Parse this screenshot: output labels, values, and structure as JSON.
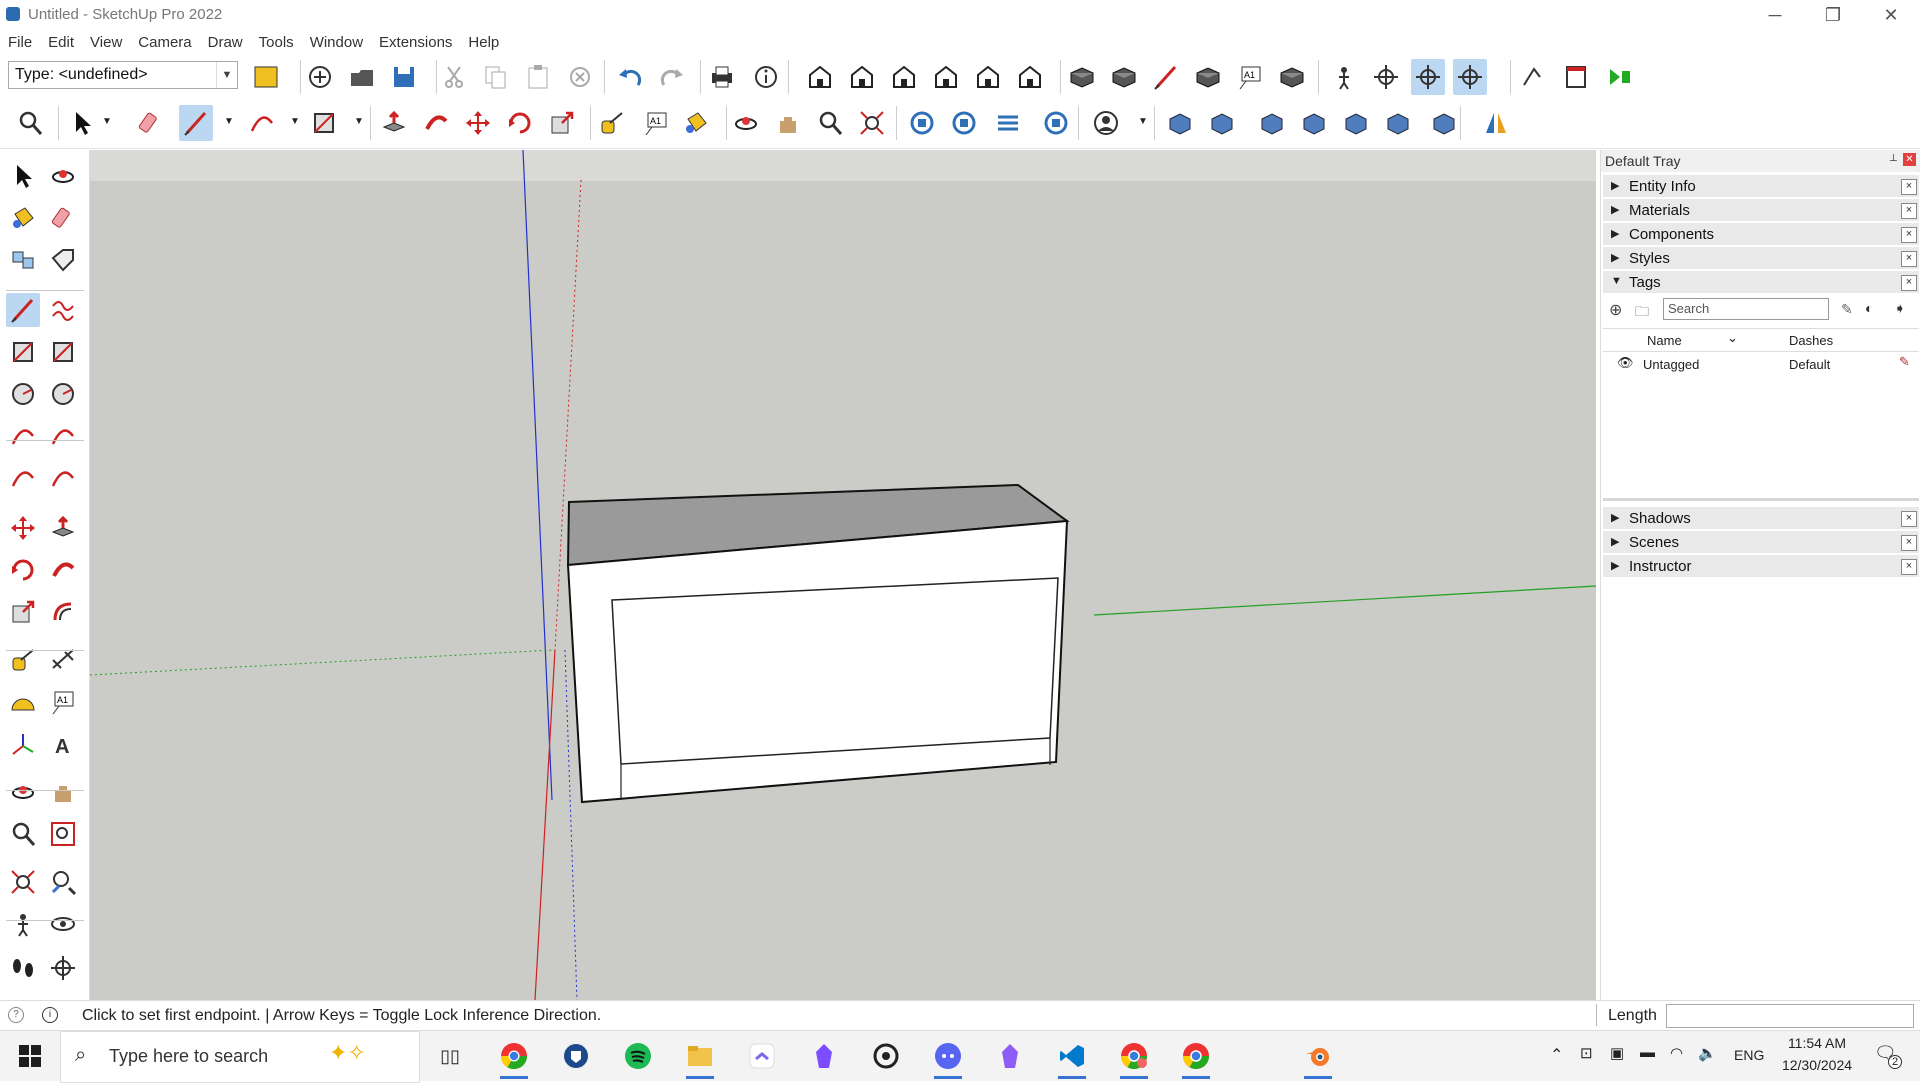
{
  "window": {
    "title": "Untitled - SketchUp Pro 2022",
    "min": "─",
    "restore": "❐",
    "close": "✕"
  },
  "menu": [
    "File",
    "Edit",
    "View",
    "Camera",
    "Draw",
    "Tools",
    "Window",
    "Extensions",
    "Help"
  ],
  "toolbar": {
    "type_selector": "Type: <undefined>",
    "top_row_icons": [
      "component-options-icon",
      "new-icon",
      "open-icon",
      "save-icon",
      "cut-icon",
      "copy-icon",
      "paste-icon",
      "erase-icon",
      "undo-icon",
      "redo-icon",
      "print-icon",
      "model-info-icon",
      "iso-view-icon",
      "top-view-icon",
      "front-view-icon",
      "right-view-icon",
      "back-view-icon",
      "left-view-icon",
      "xray-icon",
      "wireframe-icon",
      "hidden-line-icon",
      "shaded-icon",
      "shaded-texture-icon",
      "monochrome-icon",
      "position-camera-icon",
      "section-plane-icon",
      "display-section-planes-icon",
      "display-section-cuts-icon",
      "add-location-icon",
      "generate-report-icon",
      "extension-icon"
    ],
    "second_row_icons": [
      "zoom-icon",
      "select-icon",
      "eraser-icon",
      "pencil-icon",
      "arc-icon",
      "rectangle-icon",
      "push-pull-icon",
      "follow-me-icon",
      "move-icon",
      "rotate-icon",
      "scale-icon",
      "tape-measure-icon",
      "text-icon",
      "paint-bucket-icon",
      "orbit-icon",
      "pan-icon",
      "zoom-glass-icon",
      "zoom-extents-icon",
      "warehouse-icon",
      "extension-warehouse-icon",
      "layout-icon",
      "extension-manager-icon",
      "account-icon",
      "iso-box-icon",
      "wire-box-icon",
      "top-box-icon",
      "front-box-icon",
      "right-box-icon",
      "back-box-icon",
      "left-box-icon",
      "mirror-icon"
    ]
  },
  "left_toolbar_icons": [
    "select-icon",
    "orbit-icon",
    "paint-bucket-icon",
    "eraser-icon",
    "make-component-icon",
    "tag-icon",
    "line-icon",
    "freehand-icon",
    "rectangle-icon",
    "rotated-rect-icon",
    "circle-icon",
    "polygon-icon",
    "arc-icon",
    "pie-icon",
    "arc2-icon",
    "arc3-icon",
    "move-icon",
    "push-pull-icon",
    "rotate-icon",
    "follow-me-icon",
    "scale-icon",
    "offset-icon",
    "tape-measure-icon",
    "dimension-icon",
    "protractor-icon",
    "text-icon",
    "axes-icon",
    "3d-text-icon",
    "orbit2-icon",
    "pan-icon",
    "zoom-icon",
    "zoom-window-icon",
    "zoom-extents-icon",
    "previous-view-icon",
    "position-camera-icon",
    "look-around-icon",
    "walk-icon",
    "section-icon"
  ],
  "tray": {
    "title": "Default Tray",
    "pin": "📌",
    "close": "✕",
    "panels_top": [
      {
        "label": "Entity Info",
        "arrow": "▶"
      },
      {
        "label": "Materials",
        "arrow": "▶"
      },
      {
        "label": "Components",
        "arrow": "▶"
      },
      {
        "label": "Styles",
        "arrow": "▶"
      },
      {
        "label": "Tags",
        "arrow": "▼"
      }
    ],
    "tags": {
      "search_placeholder": "Search",
      "col_name": "Name",
      "col_dashes": "Dashes",
      "rows": [
        {
          "name": "Untagged",
          "dashes": "Default"
        }
      ]
    },
    "panels_bottom": [
      {
        "label": "Shadows",
        "arrow": "▶"
      },
      {
        "label": "Scenes",
        "arrow": "▶"
      },
      {
        "label": "Instructor",
        "arrow": "▶"
      }
    ]
  },
  "status": {
    "message": "Click to set first endpoint. | Arrow Keys = Toggle Lock Inference Direction.",
    "measure_label": "Length",
    "measure_value": ""
  },
  "taskbar": {
    "search_placeholder": "Type here to search",
    "apps": [
      "start-icon",
      "search-icon",
      "task-view-icon",
      "chrome-icon",
      "app-shield-icon",
      "spotify-icon",
      "file-explorer-icon",
      "clickup-icon",
      "obsidian-icon",
      "chatgpt-icon",
      "discord-icon",
      "obsidian2-icon",
      "vscode-icon",
      "chrome-profile-icon",
      "chrome2-icon",
      "blender-icon"
    ],
    "language": "ENG",
    "time": "11:54 AM",
    "date": "12/30/2024",
    "notifications": "2"
  },
  "colors": {
    "viewport_bg": "#cbcbc7",
    "axis_red": "#cc2222",
    "axis_green": "#22a022",
    "axis_blue": "#2233cc",
    "selected_tool": "#bcd7f2"
  }
}
